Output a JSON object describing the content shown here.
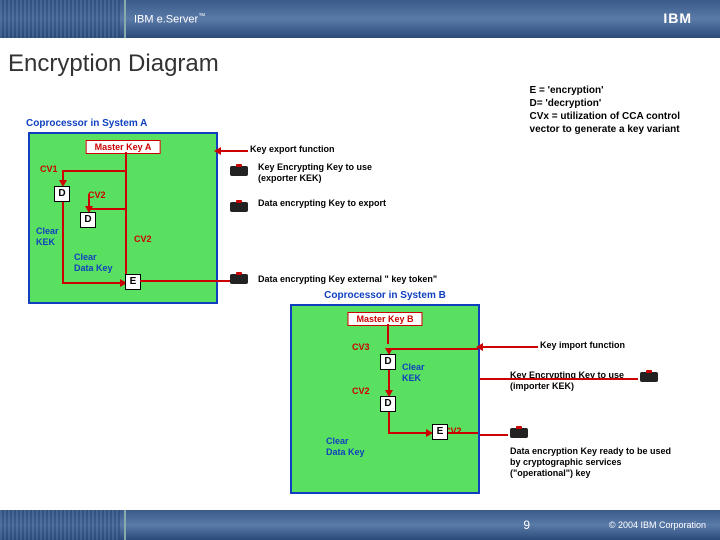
{
  "header": {
    "product": "IBM e.Server",
    "tm": "™",
    "logo": "IBM"
  },
  "title": "Encryption Diagram",
  "legend": {
    "line1": "E = 'encryption'",
    "line2": "D= 'decryption'",
    "line3": "CVx = utilization of CCA control",
    "line4": "vector to generate a key variant"
  },
  "coprocessorA": {
    "title": "Coprocessor in System A",
    "masterKey": "Master Key A",
    "cv1": "CV1",
    "cv2a": "CV2",
    "cv2b": "CV2",
    "clearKek": "Clear\nKEK",
    "clearDataKey": "Clear\nData Key"
  },
  "coprocessorB": {
    "title": "Coprocessor in System B",
    "masterKey": "Master Key B",
    "cv3": "CV3",
    "cv2a": "CV2",
    "cv2b": "CV2",
    "clearKek": "Clear\nKEK",
    "clearDataKey": "Clear\nData Key"
  },
  "labels": {
    "keyExport": "Key export function",
    "kekExporter": "Key Encrypting Key to use (exporter KEK)",
    "dataEncKeyExport": "Data encrypting Key to export",
    "externalKeyToken": "Data encrypting Key external \" key token\"",
    "keyImport": "Key import function",
    "kekImporter": "Key Encrypting Key to use (importer KEK)",
    "dataEncKeyReady": "Data encryption Key ready to be used by cryptographic services (\"operational\") key"
  },
  "boxes": {
    "d": "D",
    "e": "E"
  },
  "footer": {
    "page": "9",
    "copyright": "© 2004 IBM Corporation"
  }
}
